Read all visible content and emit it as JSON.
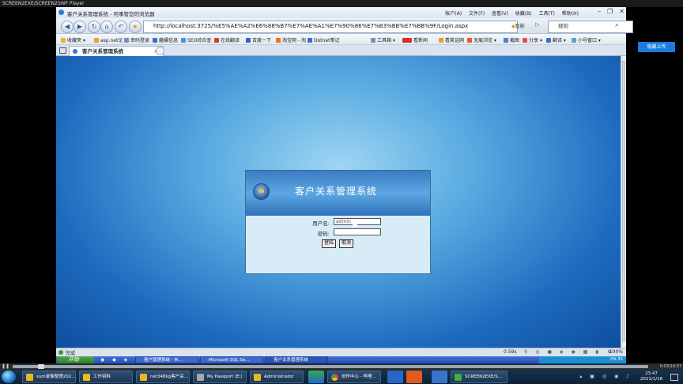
{
  "player": {
    "title": "SCREEN2EXE/SCREEN2SWF Player",
    "seek_time": "0:03/10:37",
    "progress": 0.04
  },
  "browser": {
    "window_title": "客户关系管理系统 - 何事管您的浏览器",
    "menu": [
      "帐户(A)",
      "文件(F)",
      "查看(V)",
      "收藏(B)",
      "工具(T)",
      "帮助(H)"
    ],
    "address": "http://localhost:3725/%E5%AE%A2%E6%88%B7%E7%AE%A1%E7%90%86%E7%B3%BB%E7%BB%9F/Login.aspx",
    "search_placeholder": "搜狗",
    "search_engine_label": "智能",
    "favorites": [
      "收藏夹",
      "asp.net论",
      "密码登录",
      "繼續信息",
      "SEO综合查",
      "在线翻译",
      "百度一下",
      "淘宝网 - 淘",
      "Dotnet笔记",
      "工具箱",
      "看新闻",
      "看笑话网",
      "无痕浏览",
      "截图",
      "分享",
      "翻译",
      "小号窗口"
    ],
    "tab_label": "客户关系管理系统",
    "status": {
      "left": "完成",
      "speed": "0.59s",
      "zoom": "100%"
    }
  },
  "login": {
    "title": "客户关系管理系统",
    "username_label": "用户名:",
    "username_value": "admin",
    "password_label": "密码:",
    "login_button": "登陆",
    "cancel_button": "取消"
  },
  "ie_taskbar": {
    "start_label": "开始",
    "tasks": [
      "客户管理系统 - M...",
      "Microsoft SQL Se...",
      "客户关系管理系统"
    ],
    "clock": "09:35"
  },
  "upload_button": "隐藏上传",
  "win_taskbar": {
    "tasks": [
      "sum录像整理202...",
      "工作资料",
      "net348kg客户关...",
      "My Passport (E:)",
      "Administrator",
      "创作中心 - 哔哩...",
      "SCREEN2EXE/S..."
    ],
    "time": "23:47",
    "date": "2021/1/18"
  },
  "colors": {
    "content_blue": "#1d6bbf",
    "login_header": "#3a7cc4",
    "taskbar": "#2450b8",
    "upload_blue": "#1b7be0"
  }
}
